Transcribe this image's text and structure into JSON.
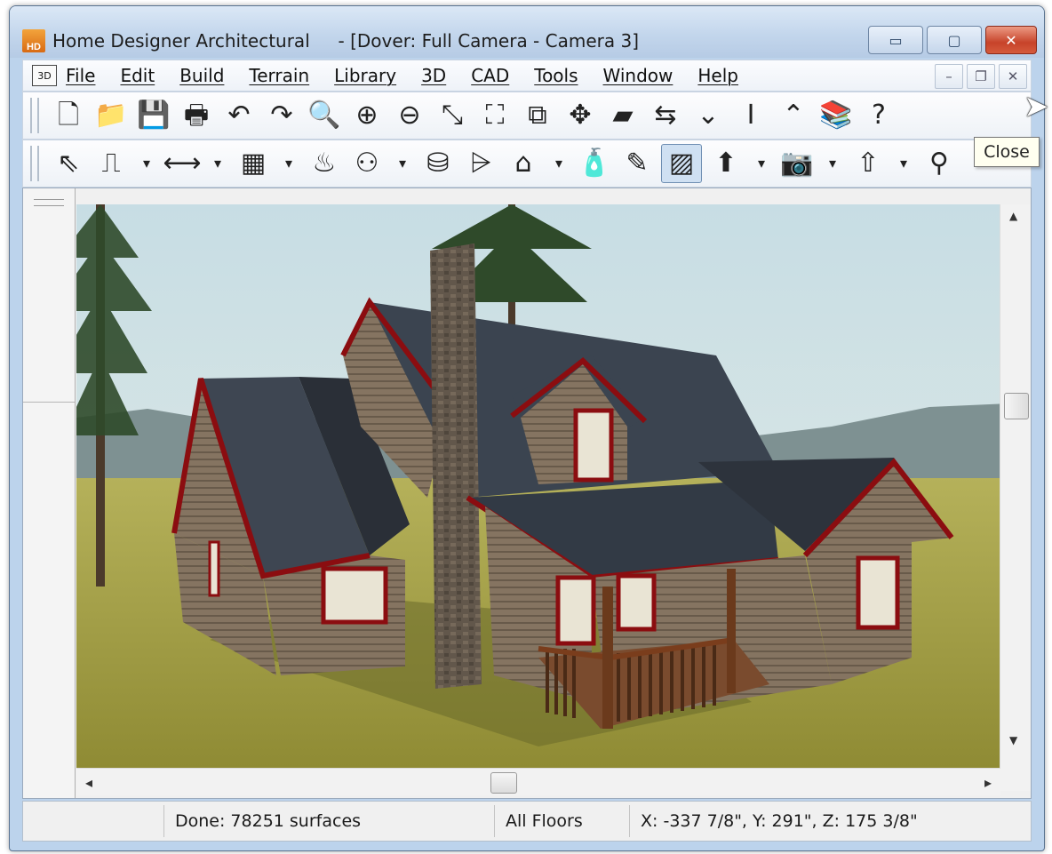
{
  "window": {
    "app_icon_label": "HD",
    "title": "Home Designer Architectural     - [Dover: Full Camera - Camera 3]",
    "minimize_glyph": "▭",
    "maximize_glyph": "▢",
    "close_glyph": "✕"
  },
  "menubar": {
    "doc_icon": "3D",
    "items": [
      "File",
      "Edit",
      "Build",
      "Terrain",
      "Library",
      "3D",
      "CAD",
      "Tools",
      "Window",
      "Help"
    ],
    "mdi_minimize": "–",
    "mdi_restore": "❐",
    "mdi_close": "✕"
  },
  "toolbar_main": {
    "icons": [
      {
        "name": "new-file-icon",
        "glyph": "🗋"
      },
      {
        "name": "open-folder-icon",
        "glyph": "📁"
      },
      {
        "name": "save-icon",
        "glyph": "💾"
      },
      {
        "name": "print-icon",
        "glyph": "🖶"
      },
      {
        "name": "undo-icon",
        "glyph": "↶"
      },
      {
        "name": "redo-icon",
        "glyph": "↷"
      },
      {
        "name": "zoom-icon",
        "glyph": "🔍"
      },
      {
        "name": "zoom-in-icon",
        "glyph": "⊕"
      },
      {
        "name": "zoom-out-icon",
        "glyph": "⊖"
      },
      {
        "name": "undo-zoom-icon",
        "glyph": "⤡"
      },
      {
        "name": "fill-window-icon",
        "glyph": "⛶"
      },
      {
        "name": "fill-window-building-icon",
        "glyph": "⧉"
      },
      {
        "name": "pan-icon",
        "glyph": "✥"
      },
      {
        "name": "floor-down-icon",
        "glyph": "▰"
      },
      {
        "name": "floor-up-icon",
        "glyph": "⇆"
      },
      {
        "name": "down-one-floor-icon",
        "glyph": "⌄"
      },
      {
        "name": "floor-indicator-icon",
        "glyph": "Ⅰ"
      },
      {
        "name": "up-one-floor-icon",
        "glyph": "⌃"
      },
      {
        "name": "library-icon",
        "glyph": "📚"
      },
      {
        "name": "help-icon",
        "glyph": "?"
      }
    ]
  },
  "toolbar_build": {
    "icons": [
      {
        "name": "select-objects-icon",
        "glyph": "⇖",
        "active": false
      },
      {
        "name": "wall-tools-icon",
        "glyph": "⎍",
        "active": false
      },
      {
        "name": "dropdown-arrow-icon",
        "glyph": "▾",
        "active": false,
        "small": true
      },
      {
        "name": "dimension-icon",
        "glyph": "⟷",
        "active": false
      },
      {
        "name": "dropdown-arrow-icon",
        "glyph": "▾",
        "active": false,
        "small": true
      },
      {
        "name": "cabinet-icon",
        "glyph": "▦",
        "active": false
      },
      {
        "name": "dropdown-arrow-icon",
        "glyph": "▾",
        "active": false,
        "small": true
      },
      {
        "name": "fireplace-icon",
        "glyph": "♨",
        "active": false
      },
      {
        "name": "electrical-outlet-icon",
        "glyph": "⚇",
        "active": false
      },
      {
        "name": "dropdown-arrow-icon",
        "glyph": "▾",
        "active": false,
        "small": true
      },
      {
        "name": "material-eyedropper-icon",
        "glyph": "⛁",
        "active": false
      },
      {
        "name": "plant-chooser-icon",
        "glyph": "⩥",
        "active": false
      },
      {
        "name": "house-view-icon",
        "glyph": "⌂",
        "active": false
      },
      {
        "name": "dropdown-arrow-icon",
        "glyph": "▾",
        "active": false,
        "small": true
      },
      {
        "name": "spray-paint-icon",
        "glyph": "🧴",
        "active": false
      },
      {
        "name": "eyedropper-icon",
        "glyph": "✎",
        "active": false
      },
      {
        "name": "material-painter-icon",
        "glyph": "▨",
        "active": true
      },
      {
        "name": "camera-icon",
        "glyph": "⬆",
        "active": false
      },
      {
        "name": "dropdown-arrow-icon",
        "glyph": "▾",
        "active": false,
        "small": true
      },
      {
        "name": "camera-tools-icon",
        "glyph": "📷",
        "active": false
      },
      {
        "name": "dropdown-arrow-icon",
        "glyph": "▾",
        "active": false,
        "small": true
      },
      {
        "name": "move-up-arrow-icon",
        "glyph": "⇧",
        "active": false
      },
      {
        "name": "dropdown-arrow-icon",
        "glyph": "▾",
        "active": false,
        "small": true
      },
      {
        "name": "walkthrough-icon",
        "glyph": "⚲",
        "active": false
      }
    ]
  },
  "tooltip": {
    "text": "Close"
  },
  "scrollbars": {
    "up": "▲",
    "down": "▼",
    "left": "◂",
    "right": "▸"
  },
  "status": {
    "message": "Done:  78251 surfaces",
    "floors": "All Floors",
    "coords": "X: -337 7/8\", Y: 291\", Z: 175 3/8\""
  },
  "colors": {
    "roof": "#3b4450",
    "siding": "#7a6a58",
    "trim": "#8b0d10",
    "grass": "#9e9a44",
    "sky": "#d8e6ea",
    "chimney": "#5f5448"
  }
}
